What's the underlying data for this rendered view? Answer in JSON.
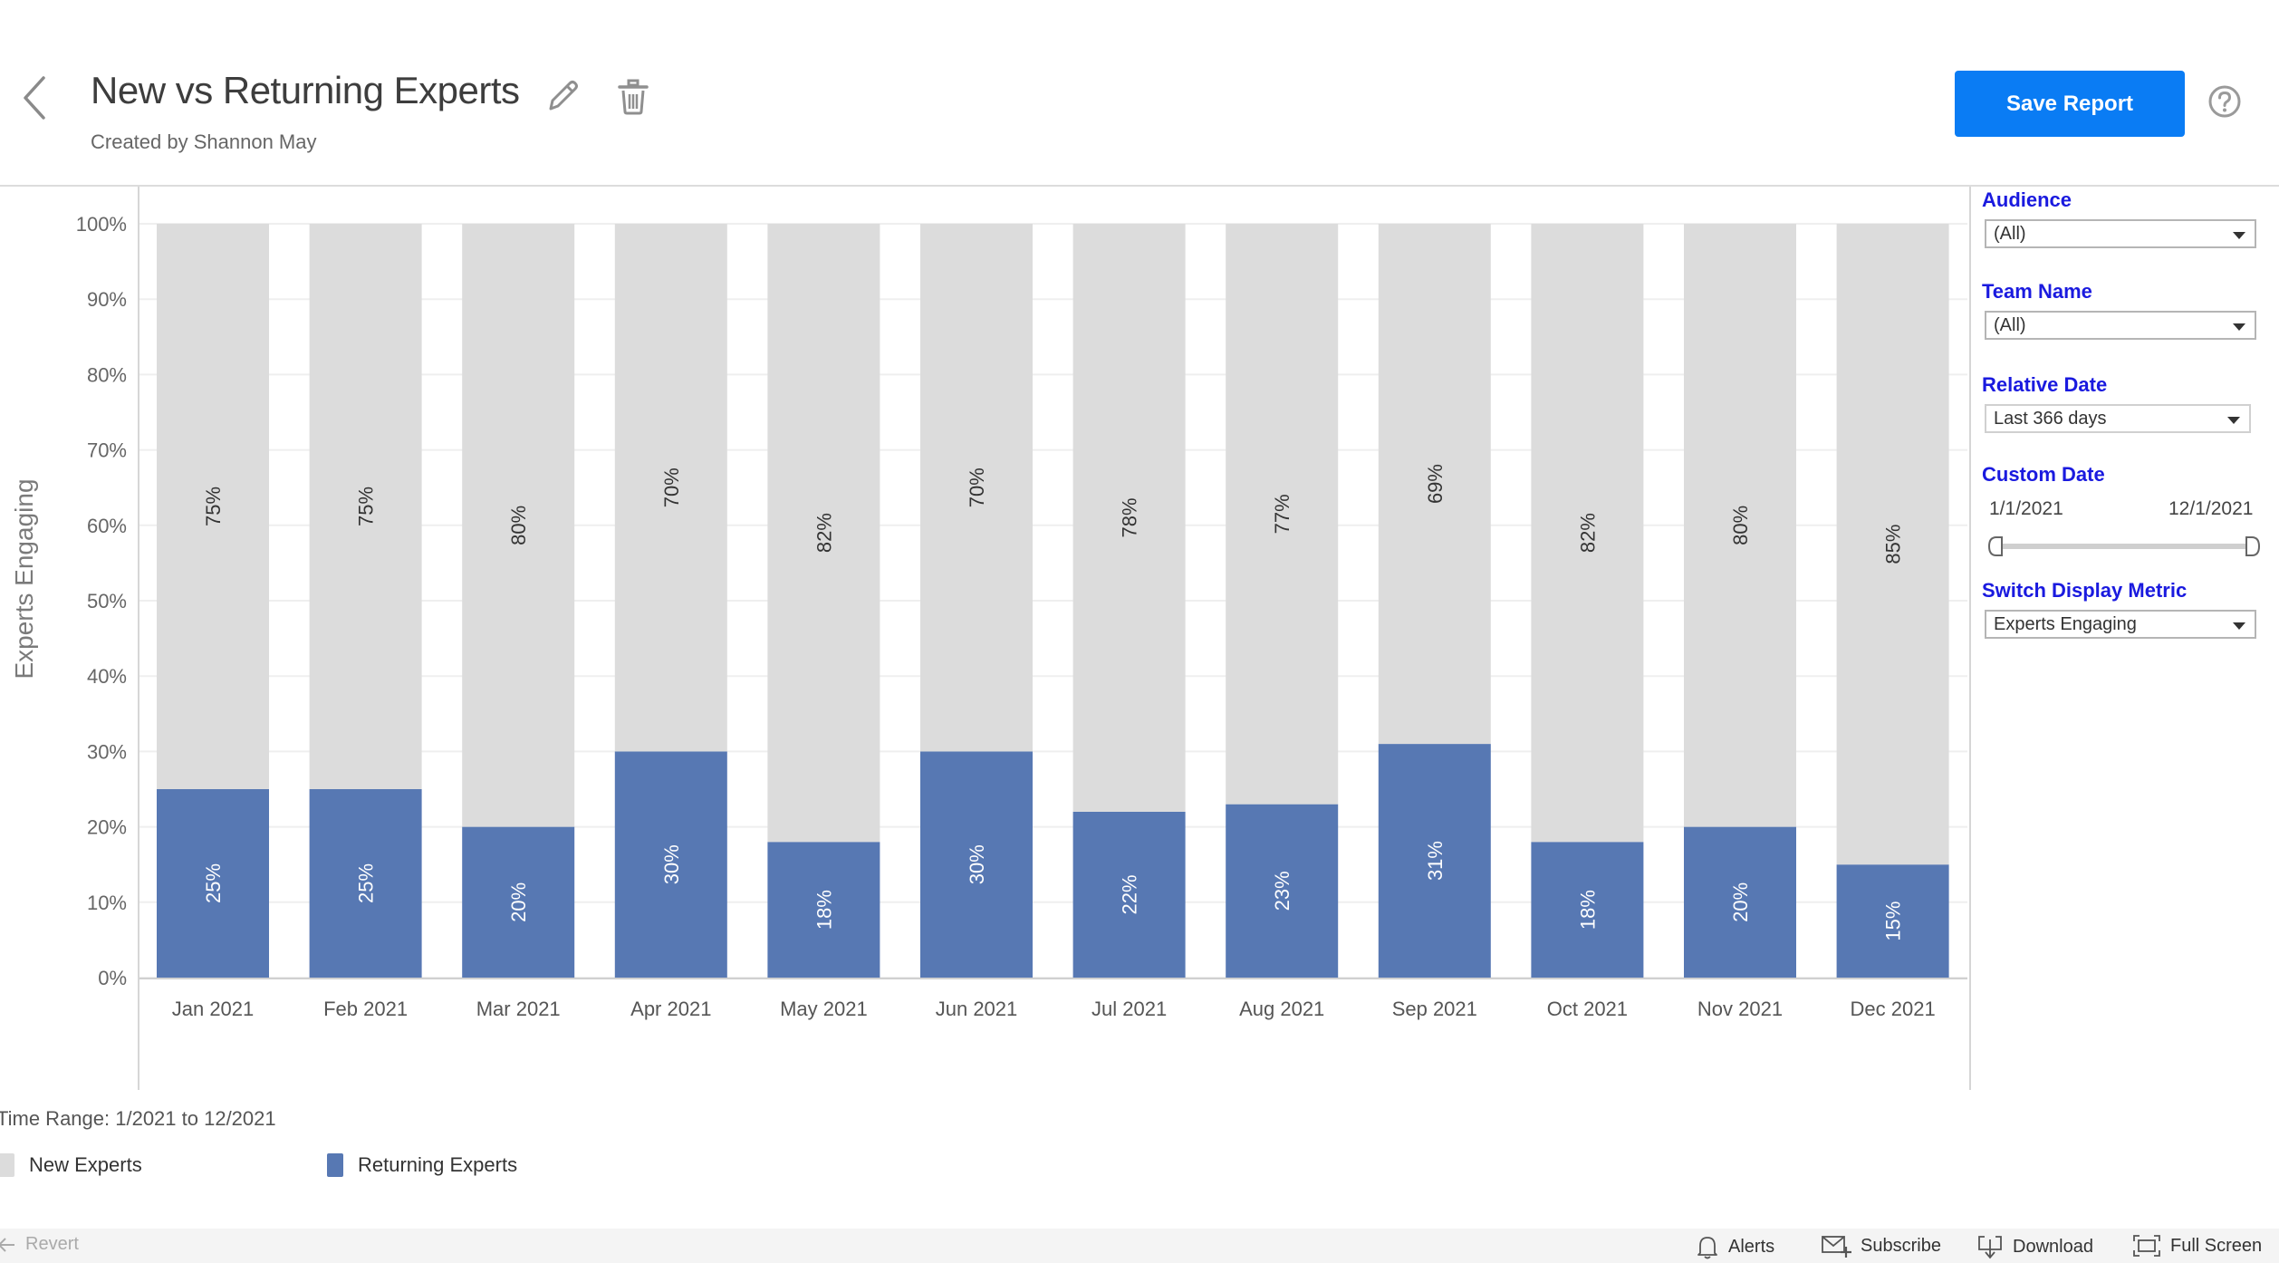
{
  "header": {
    "title": "New vs Returning Experts",
    "subtitle": "Created by Shannon May",
    "save_label": "Save Report",
    "icons": {
      "back": "chevron-left-icon",
      "edit": "pencil-icon",
      "delete": "trash-icon",
      "help": "question-circle-icon"
    }
  },
  "filters": {
    "audience": {
      "label": "Audience",
      "value": "(All)"
    },
    "team_name": {
      "label": "Team Name",
      "value": "(All)"
    },
    "relative_date": {
      "label": "Relative Date",
      "value": "Last 366 days"
    },
    "custom_date": {
      "label": "Custom Date",
      "start": "1/1/2021",
      "end": "12/1/2021"
    },
    "display_metric": {
      "label": "Switch Display Metric",
      "value": "Experts Engaging"
    }
  },
  "legend": {
    "time_range": "Time Range: 1/2021 to 12/2021",
    "items": [
      {
        "label": "New Experts",
        "color": "#dcdcdc"
      },
      {
        "label": "Returning Experts",
        "color": "#5778b3"
      }
    ]
  },
  "footer": {
    "revert": "Revert",
    "alerts": "Alerts",
    "subscribe": "Subscribe",
    "download": "Download",
    "full_screen": "Full Screen"
  },
  "chart_data": {
    "type": "bar",
    "stacked": true,
    "title": "",
    "xlabel": "",
    "ylabel": "Experts Engaging",
    "ylim": [
      0,
      100
    ],
    "yticks": [
      "0%",
      "10%",
      "20%",
      "30%",
      "40%",
      "50%",
      "60%",
      "70%",
      "80%",
      "90%",
      "100%"
    ],
    "grid": true,
    "legend_position": "bottom-left",
    "categories": [
      "Jan 2021",
      "Feb 2021",
      "Mar 2021",
      "Apr 2021",
      "May 2021",
      "Jun 2021",
      "Jul 2021",
      "Aug 2021",
      "Sep 2021",
      "Oct 2021",
      "Nov 2021",
      "Dec 2021"
    ],
    "series": [
      {
        "name": "Returning Experts",
        "color": "#5778b3",
        "label_color": "#ffffff",
        "values": [
          25,
          25,
          20,
          30,
          18,
          30,
          22,
          23,
          31,
          18,
          20,
          15
        ]
      },
      {
        "name": "New Experts",
        "color": "#dcdcdc",
        "label_color": "#333333",
        "values": [
          75,
          75,
          80,
          70,
          82,
          70,
          78,
          77,
          69,
          82,
          80,
          85
        ]
      }
    ]
  }
}
